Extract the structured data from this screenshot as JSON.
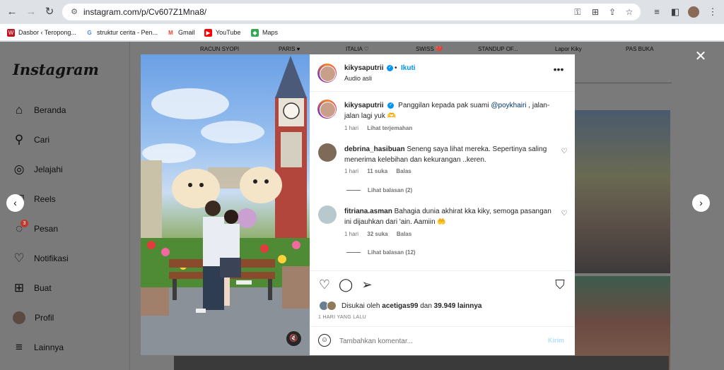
{
  "browser": {
    "url": "instagram.com/p/Cv607Z1Mna8/",
    "bookmarks": [
      {
        "label": "Dasbor ‹ Teropong...",
        "icon": "wordpress-icon",
        "color": "#c1121f"
      },
      {
        "label": "struktur cerita - Pen...",
        "icon": "google-icon",
        "color": "#4285f4"
      },
      {
        "label": "Gmail",
        "icon": "gmail-icon",
        "color": "#ea4335"
      },
      {
        "label": "YouTube",
        "icon": "youtube-icon",
        "color": "#ff0000"
      },
      {
        "label": "Maps",
        "icon": "maps-icon",
        "color": "#34a853"
      }
    ]
  },
  "sidebar": {
    "logo": "Instagram",
    "items": [
      {
        "label": "Beranda",
        "icon": "home-icon"
      },
      {
        "label": "Cari",
        "icon": "search-icon"
      },
      {
        "label": "Jelajahi",
        "icon": "compass-icon"
      },
      {
        "label": "Reels",
        "icon": "reels-icon"
      },
      {
        "label": "Pesan",
        "icon": "messenger-icon",
        "badge": "3"
      },
      {
        "label": "Notifikasi",
        "icon": "heart-icon"
      },
      {
        "label": "Buat",
        "icon": "plus-square-icon"
      },
      {
        "label": "Profil",
        "icon": "avatar"
      },
      {
        "label": "Lainnya",
        "icon": "menu-icon"
      }
    ]
  },
  "highlights": [
    "RACUN SYOPI",
    "PARIS ♥",
    "ITALIA ♡",
    "SWISS 💔",
    "STANDUP OF...",
    "Lapor Kiky",
    "PAS BUKA"
  ],
  "post": {
    "username": "kikysaputrii",
    "follow_label": "Ikuti",
    "separator": "•",
    "audio": "Audio asli",
    "caption": {
      "username": "kikysaputrii",
      "text_before": "Panggilan kepada pak suami ",
      "mention": "@poykhairi",
      "text_after": " , jalan-jalan lagi yuk 🫶",
      "time": "1 hari",
      "translate": "Lihat terjemahan"
    },
    "comments": [
      {
        "username": "debrina_hasibuan",
        "text": "Seneng saya lihat mereka. Sepertinya saling menerima kelebihan dan kekurangan ..keren.",
        "time": "1 hari",
        "likes": "11 suka",
        "reply": "Balas",
        "replies": "Lihat balasan (2)",
        "avatar_color": "#7d6a58"
      },
      {
        "username": "fitriana.asman",
        "text": "Bahagia dunia akhirat kka kiky, semoga pasangan ini dijauhkan dari 'ain. Aamiin 🤲",
        "time": "1 hari",
        "likes": "32 suka",
        "reply": "Balas",
        "replies": "Lihat balasan (12)",
        "avatar_color": "#b9c8cc"
      }
    ],
    "likes": {
      "prefix": "Disukai oleh ",
      "user": "acetigas99",
      "middle": " dan ",
      "count": "39.949 lainnya"
    },
    "time_ago": "1 HARI YANG LALU",
    "comment_placeholder": "Tambahkan komentar...",
    "post_label": "Kirim"
  }
}
